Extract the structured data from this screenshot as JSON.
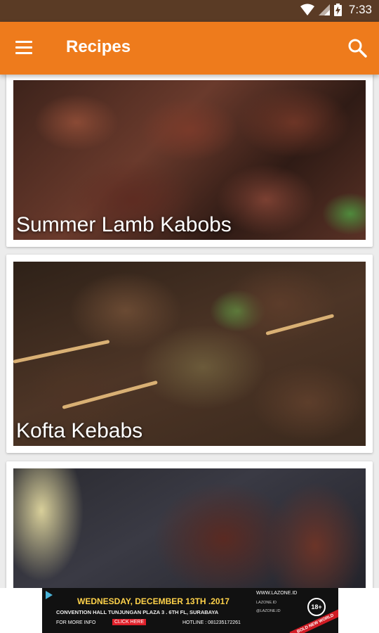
{
  "status_bar": {
    "time": "7:33"
  },
  "app_bar": {
    "title": "Recipes",
    "menu_icon": "hamburger-menu-icon",
    "search_icon": "search-icon"
  },
  "recipes": [
    {
      "title": "Summer Lamb Kabobs"
    },
    {
      "title": "Kofta Kebabs"
    },
    {
      "title": ""
    }
  ],
  "ad": {
    "line1": "WEDNESDAY, DECEMBER 13TH .2017",
    "line2": "CONVENTION HALL TUNJUNGAN PLAZA 3 . 6TH FL, SURABAYA",
    "more_info": "FOR MORE INFO",
    "click_here": "CLICK HERE",
    "hotline": "HOTLINE : 081235172261",
    "site": "WWW.LAZONE.ID",
    "social1": "LAZONE.ID",
    "social2": "@LAZONE.ID",
    "age": "18+",
    "ribbon": "BOLD NEW WORLD"
  },
  "colors": {
    "primary": "#ee7b1c",
    "status_bar": "#5a3b25"
  }
}
